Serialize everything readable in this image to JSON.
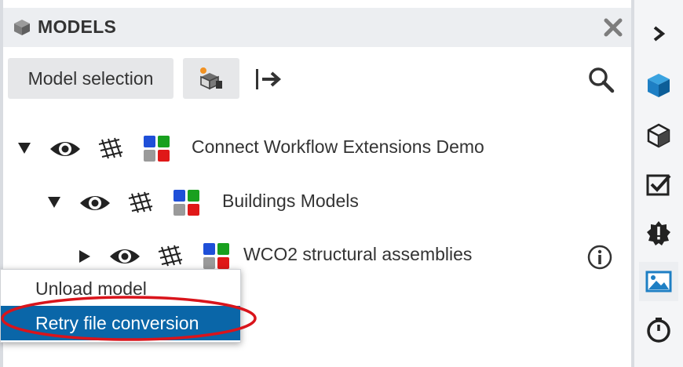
{
  "panel": {
    "title": "MODELS",
    "close_icon": "close-icon"
  },
  "toolbar": {
    "model_selection_label": "Model selection",
    "load_icon": "load-model-icon",
    "export_icon": "export-arrow-icon",
    "search_icon": "search-icon"
  },
  "tree": [
    {
      "label": "Connect Workflow Extensions Demo",
      "expanded": true
    },
    {
      "label": "Buildings Models",
      "expanded": true
    },
    {
      "label": "WCO2 structural assemblies",
      "expanded": false,
      "info_icon": "info-icon"
    }
  ],
  "context_menu": {
    "items": [
      "Unload model",
      "Retry file conversion"
    ],
    "selected_index": 1
  },
  "right_rail": {
    "items": [
      "collapse-chevron-icon",
      "models-cube-icon",
      "cube-outline-icon",
      "checklist-icon",
      "badge-alert-icon",
      "image-icon",
      "timer-icon"
    ],
    "active_index": 5
  },
  "colors": {
    "accent": "#0a66a8",
    "highlight_ring": "#d9141b",
    "palette": [
      "#1f4fd8",
      "#19a01f",
      "#9a9a9a",
      "#e01818"
    ]
  }
}
